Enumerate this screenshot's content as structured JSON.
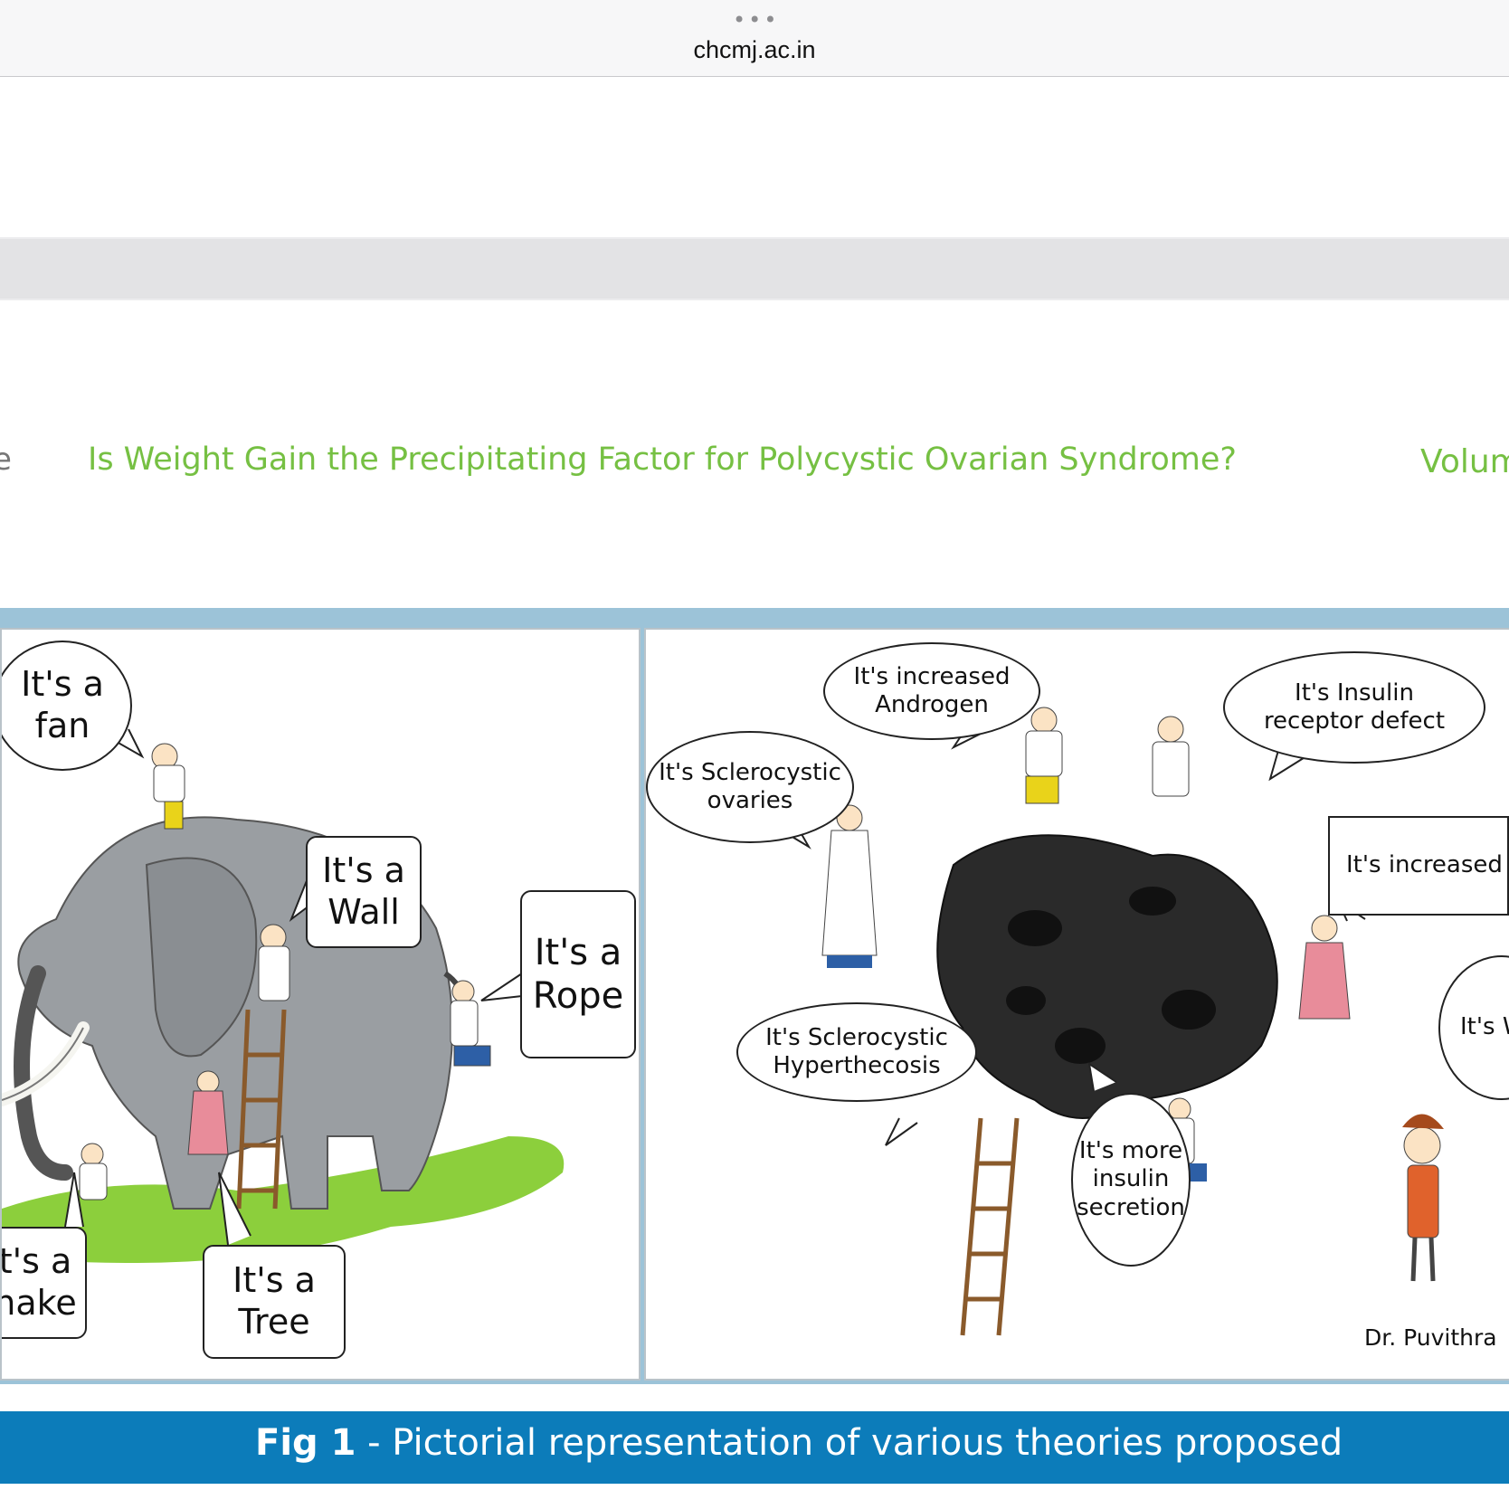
{
  "browser": {
    "tabs_indicator": "•••",
    "url": "chcmj.ac.in"
  },
  "header": {
    "left_partial": "e",
    "title": "Is Weight Gain the Precipitating Factor for Polycystic Ovarian Syndrome?",
    "right_partial": "Volum"
  },
  "figure": {
    "left_bubbles": {
      "fan": "It's a\nfan",
      "wall": "It's a\nWall",
      "rope": "It's a\nRope",
      "snake": "t's a\nhake",
      "tree": "It's a\nTree"
    },
    "right_bubbles": {
      "androgen": "It's increased\nAndrogen",
      "sclerocystic_ovaries": "It's Sclerocystic\novaries",
      "insulin_receptor": "It's Insulin\nreceptor defect",
      "increased_lh": "It's increased LH",
      "partial_w": "It's W",
      "hyperthecosis": "It's Sclerocystic\nHyperthecosis",
      "insulin_secretion": "It's more\ninsulin\nsecretion"
    },
    "signature": "Dr. Puvithra",
    "colors": {
      "title_green": "#76c043",
      "caption_blue": "#0c7cba",
      "frame_blue": "#9cc3d8",
      "elephant_gray": "#9a9ea2",
      "grass_green": "#8ccf3c",
      "ovary_dark": "#2a2a2a"
    }
  },
  "caption": {
    "label": "Fig 1",
    "text": " - Pictorial representation of various theories proposed"
  }
}
